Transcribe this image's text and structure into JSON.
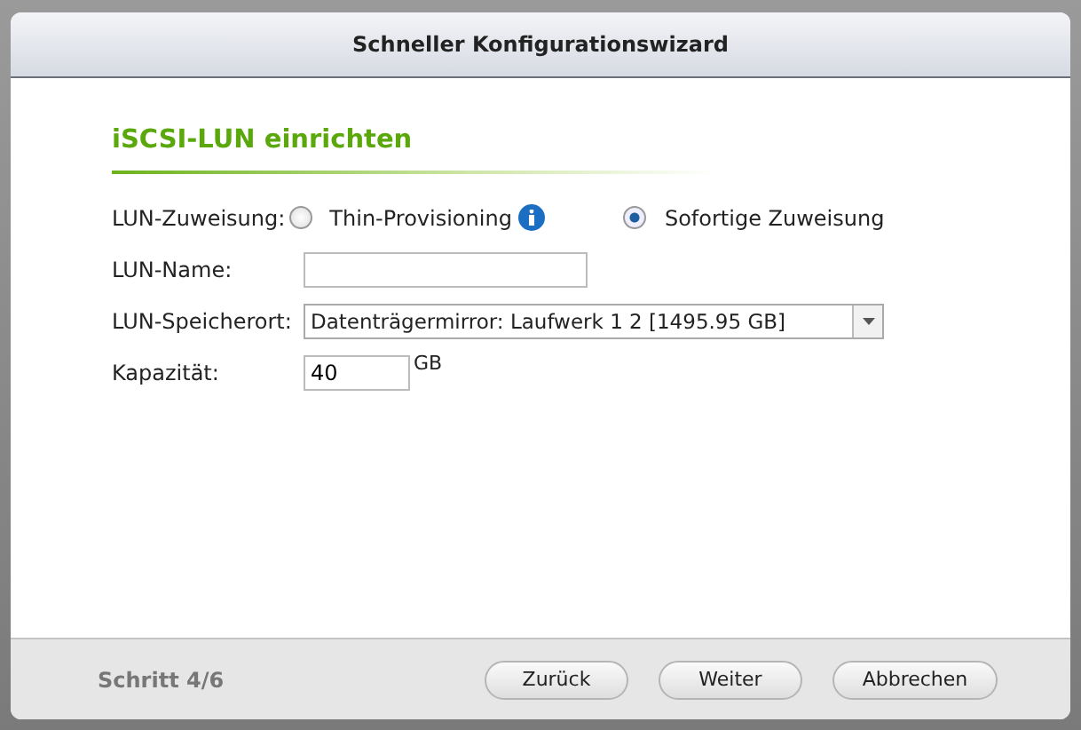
{
  "window": {
    "title": "Schneller Konfigurationswizard"
  },
  "section": {
    "title": "iSCSI-LUN einrichten"
  },
  "allocation": {
    "label": "LUN-Zuweisung:",
    "options": [
      {
        "label": "Thin-Provisioning",
        "selected": false,
        "info": true
      },
      {
        "label": "Sofortige Zuweisung",
        "selected": true,
        "info": false
      }
    ]
  },
  "name": {
    "label": "LUN-Name:"
  },
  "location": {
    "label": "LUN-Speicherort:",
    "value": "Datenträgermirror: Laufwerk  1 2 [1495.95 GB]"
  },
  "capacity": {
    "label": "Kapazität:",
    "value": "40",
    "unit": "GB"
  },
  "footer": {
    "step": "Schritt 4/6",
    "buttons": [
      "Zurück",
      "Weiter",
      "Abbrechen"
    ]
  }
}
